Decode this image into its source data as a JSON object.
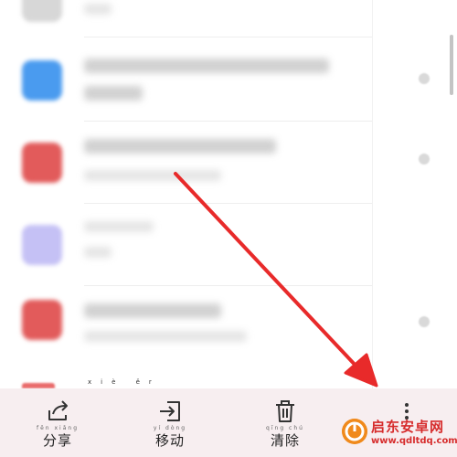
{
  "hint": {
    "text": "xiè ěr"
  },
  "toolbar": {
    "items": [
      {
        "id": "share",
        "label": "分享",
        "pinyin": "fēn xiǎng",
        "icon": "share-icon"
      },
      {
        "id": "move",
        "label": "移动",
        "pinyin": "yí dòng",
        "icon": "move-icon"
      },
      {
        "id": "clear",
        "label": "清除",
        "pinyin": "qīng chú",
        "icon": "trash-icon"
      },
      {
        "id": "more",
        "label": "",
        "pinyin": "",
        "icon": "more-vertical-icon"
      }
    ]
  },
  "watermark": {
    "title": "启东安卓网",
    "url": "www.qdltdq.com"
  },
  "colors": {
    "toolbar_bg": "#f7eef0",
    "arrow": "#e82a2a",
    "icon_blue": "#4a9bef",
    "icon_red": "#e25b5b",
    "icon_purple": "#c5c1f5"
  }
}
